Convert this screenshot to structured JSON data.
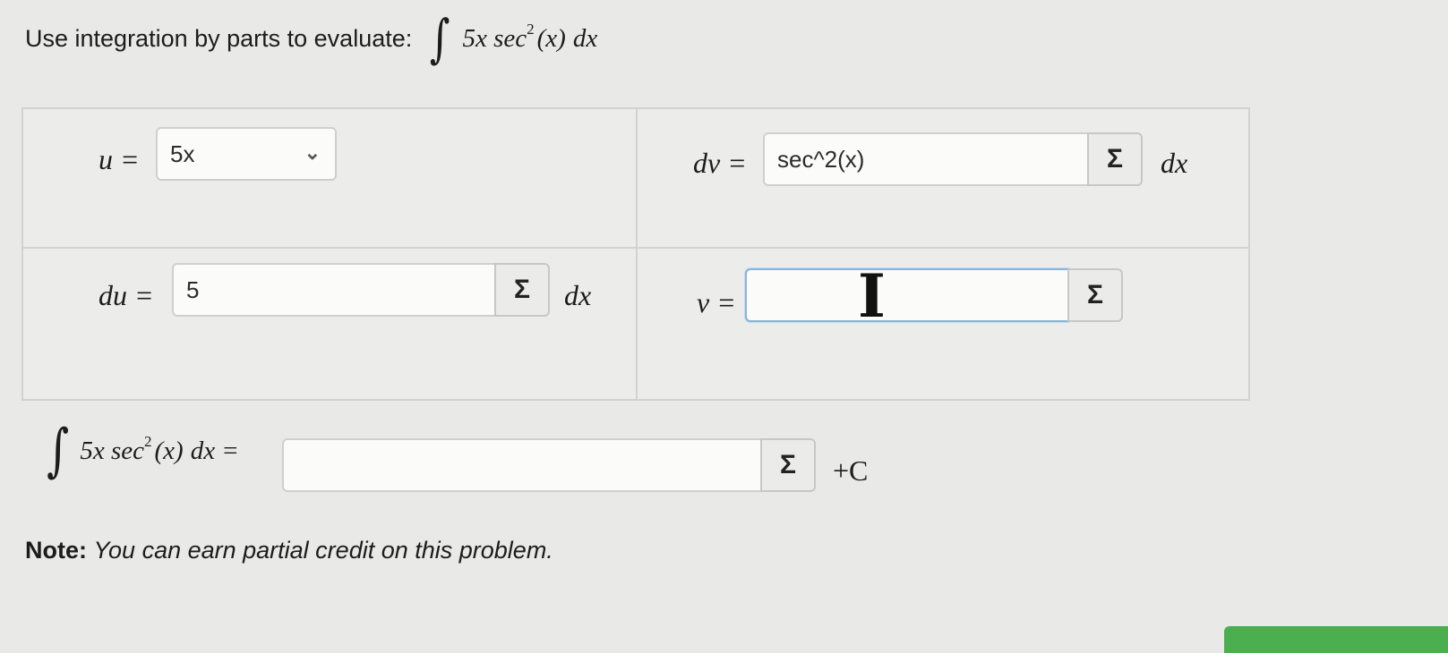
{
  "prompt": {
    "text": "Use integration by parts to evaluate:",
    "integrand_coef": "5x sec",
    "integrand_exp": "2",
    "integrand_arg": "(x)",
    "integrand_dx": "dx"
  },
  "grid": {
    "u_label": "u =",
    "u_value": "5x",
    "dv_label": "dv =",
    "dv_value": "sec^2(x)",
    "dv_suffix": "dx",
    "du_label": "du =",
    "du_value": "5",
    "du_suffix": "dx",
    "v_label": "v =",
    "v_value": ""
  },
  "answer": {
    "lhs_coef": "5x sec",
    "lhs_exp": "2",
    "lhs_arg": "(x)",
    "lhs_dx": "dx =",
    "value": "",
    "suffix": "+C"
  },
  "sigma_symbol": "Σ",
  "note": {
    "bold": "Note:",
    "italic": "You can earn partial credit on this problem."
  },
  "icons": {
    "dropdown": "chevron-down-icon",
    "equation_editor": "sigma-icon",
    "text_cursor": "i-beam-cursor-icon"
  },
  "colors": {
    "focus_border": "#8ab4d8",
    "submit_green": "#4caf4f"
  }
}
